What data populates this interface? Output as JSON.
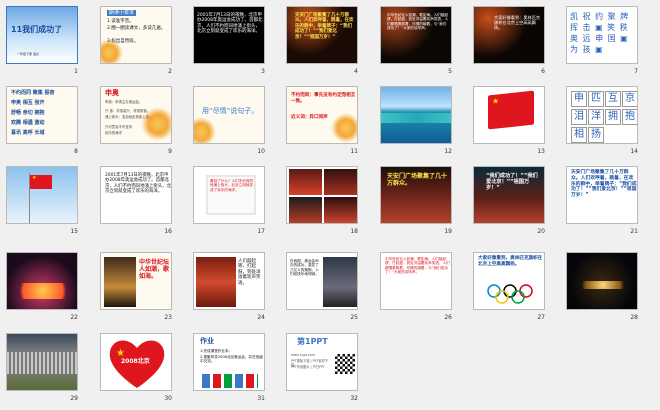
{
  "slides": [
    {
      "n": "1",
      "title": "11我们成功了",
      "caption": "一年级下册 语文"
    },
    {
      "n": "2",
      "heading": "朗读小要求",
      "lines": [
        "1.读准字音。",
        "2.圈一圈读课文，多读几遍。",
        "3.标出自然段。"
      ]
    },
    {
      "n": "3",
      "text": "2001年7月13日的夜晚，北京申办2008年奥运会成功了。首都北京，人们不约而同地涌上街头，北京立刻就变成了欢乐的海洋。"
    },
    {
      "n": "4",
      "text": "天安门广场聚集了几十万群众。人们欢呼着，跳着，在欢乐的群中，举着牌子：“我们成功了！”“我们爱北京！”“祖国万岁！”"
    },
    {
      "n": "5",
      "text": "中华世纪坛人如潮，歌如海。人们敲起锣，打起鼓，到处洋溢着欢声笑语，人们都唱着跳着，尽情的喊着，与“我们成功了！”大家的欢呼声。"
    },
    {
      "n": "6",
      "text": "大家好像看到：奥林匹克旗帜在北京上空高高飘扬。"
    },
    {
      "n": "7",
      "text": "凯 祝 约 聚 牌 挥 击 ▣ 笑 秩 奥 远 申 国 ▣ 为 孩 ▣"
    },
    {
      "n": "8",
      "rows": [
        "不约而同 聚集 振奋",
        "申奥 相互 张开",
        "舒畅 亲切 拥抱",
        "欢腾 相遇 激动",
        "喜讯 高呼 长城"
      ]
    },
    {
      "n": "9",
      "heading": "申奥",
      "lines": [
        "申奥：申请主办奥运会。",
        "",
        "兴 奋：非常高兴，非常振奋。",
        "涌上街头：急迫地走到街上去。",
        "",
        "只可意会不可言传",
        "欢乐的海洋"
      ]
    },
    {
      "n": "10",
      "text": "用“尽情”说句子。"
    },
    {
      "n": "11",
      "heading": "不约而同：事先没有约定而相互一致。",
      "sub": "近义词：异口同声"
    },
    {
      "n": "12"
    },
    {
      "n": "13"
    },
    {
      "n": "14",
      "chars": [
        "申",
        "匹",
        "互",
        "京",
        "泪",
        "洋",
        "拥",
        "抱",
        "相",
        "扬"
      ]
    },
    {
      "n": "15"
    },
    {
      "n": "16",
      "text": "2001年7月13日的夜晚，北京申办2008年奥运会成功了。首都北京，人们不约而同地涌上街头，北京立刻就变成了欢乐的海洋。"
    },
    {
      "n": "17",
      "text": "看到了什么？人们不约而同地涌上街头，北京立刻就变成了欢乐的海洋。"
    },
    {
      "n": "18"
    },
    {
      "n": "19",
      "text": "天安门广场聚集了几十万群众。"
    },
    {
      "n": "20",
      "text": "“我们成功了！”“我们爱北京！”“祖国万岁！”"
    },
    {
      "n": "21",
      "text": "天安门广场聚集了几十万群众。人们欢呼着，跳着，在欢乐的群中，举着牌子：“我们成功了！”“我们爱北京！”“祖国万岁！”"
    },
    {
      "n": "22"
    },
    {
      "n": "23",
      "text": "中华世纪坛人如潮，歌如海。"
    },
    {
      "n": "24",
      "text": "人们敲起锣，打起鼓，到处洋溢着欢声笑语。"
    },
    {
      "n": "25",
      "text": "在我国，奥运会申办的成功，激发了几亿人的拥抱，人们欢快乐地呼喊。"
    },
    {
      "n": "26",
      "text": "中华世纪坛人如潮，歌如海。人们敲起锣，打起鼓，到处洋溢着欢声笑语，人们都唱着跳着，尽情的喊着，与“我们成功了！”大家的欢呼声。"
    },
    {
      "n": "27",
      "text": "大家好像看到，奥林匹克旗帜在北京上空高高飘扬。"
    },
    {
      "n": "28"
    },
    {
      "n": "29"
    },
    {
      "n": "30",
      "text": "2008北京"
    },
    {
      "n": "31",
      "heading": "作业",
      "lines": [
        "1.完成课堂作业本。",
        "2.搜集有关2008北京奥运会，并在班级中交流。"
      ]
    },
    {
      "n": "32",
      "heading": "第1PPT",
      "lines": [
        "www.1ppt.com",
        "PPT模板下载 | PPT素材下载",
        "PPT背景图片 | 节日PPT"
      ]
    }
  ],
  "colors": {
    "accent": "#3c78c8",
    "red": "#d9141c",
    "yellow": "#ffd800",
    "blue": "#1a4fa0",
    "orange": "#f3a938"
  }
}
